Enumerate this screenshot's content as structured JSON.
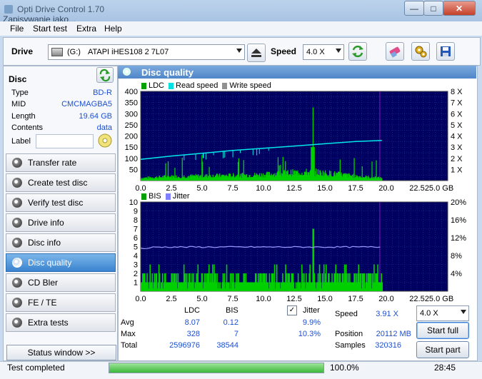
{
  "window": {
    "title": "Opti Drive Control 1.70",
    "subtitle": "Zapisywanie jako...",
    "close_label": "✕"
  },
  "menu": [
    "File",
    "Start test",
    "Extra",
    "Help"
  ],
  "toolbar": {
    "drive_label": "Drive",
    "drive_letter": "(G:)",
    "drive_name": "ATAPI iHES108   2 7L07",
    "speed_label": "Speed",
    "speed_value": "4.0 X"
  },
  "disc": {
    "header": "Disc",
    "rows": [
      {
        "label": "Type",
        "value": "BD-R"
      },
      {
        "label": "MID",
        "value": "CMCMAGBA5"
      },
      {
        "label": "Length",
        "value": "19.64 GB"
      },
      {
        "label": "Contents",
        "value": "data"
      },
      {
        "label": "Label",
        "value": ""
      }
    ]
  },
  "nav": [
    "Transfer rate",
    "Create test disc",
    "Verify test disc",
    "Drive info",
    "Disc info",
    "Disc quality",
    "CD Bler",
    "FE / TE",
    "Extra tests"
  ],
  "nav_active": 5,
  "status_window": "Status window >>",
  "panel": {
    "title": "Disc quality"
  },
  "chart_data": [
    {
      "type": "area",
      "series": [
        {
          "name": "LDC",
          "color": "#00c000"
        },
        {
          "name": "Read speed",
          "color": "#00ffff"
        },
        {
          "name": "Write speed",
          "color": "#909090"
        }
      ],
      "x_ticks": [
        "0.0",
        "2.5",
        "5.0",
        "7.5",
        "10.0",
        "12.5",
        "15.0",
        "17.5",
        "20.0",
        "22.5",
        "25.0 GB"
      ],
      "y_ticks": [
        "400",
        "350",
        "300",
        "250",
        "200",
        "150",
        "100",
        "50"
      ],
      "y2_ticks": [
        "8 X",
        "7 X",
        "6 X",
        "5 X",
        "4 X",
        "3 X",
        "2 X",
        "1 X"
      ],
      "ylim": [
        0,
        400
      ],
      "xlim": [
        0,
        25
      ],
      "data_end_x": 19.64,
      "read_speed": {
        "x": [
          0,
          2.5,
          5,
          7.5,
          10,
          12.5,
          15,
          17.5,
          19.64
        ],
        "y": [
          1.9,
          2.2,
          2.45,
          2.7,
          2.9,
          3.1,
          3.3,
          3.5,
          3.6
        ]
      },
      "ldc_baseline": {
        "x": [
          0,
          2,
          5,
          7.5,
          10,
          12,
          14,
          16,
          18,
          19.64
        ],
        "y": [
          12,
          18,
          22,
          24,
          28,
          36,
          40,
          30,
          18,
          12
        ]
      },
      "ldc_peak": {
        "x": 14.0,
        "y": 328
      }
    },
    {
      "type": "area",
      "series": [
        {
          "name": "BIS",
          "color": "#00c000"
        },
        {
          "name": "Jitter",
          "color": "#8080ff"
        }
      ],
      "x_ticks": [
        "0.0",
        "2.5",
        "5.0",
        "7.5",
        "10.0",
        "12.5",
        "15.0",
        "17.5",
        "20.0",
        "22.5",
        "25.0 GB"
      ],
      "y_ticks": [
        "10",
        "9",
        "8",
        "7",
        "6",
        "5",
        "4",
        "3",
        "2",
        "1"
      ],
      "y2_ticks": [
        "20%",
        "16%",
        "12%",
        "8%",
        "4%"
      ],
      "ylim": [
        0,
        10
      ],
      "xlim": [
        0,
        25
      ],
      "data_end_x": 19.64,
      "jitter_pct": 9.9,
      "bis_typical": 1,
      "bis_peak": {
        "x": 14.0,
        "y": 7
      }
    }
  ],
  "stats": {
    "col_ldc": "LDC",
    "col_bis": "BIS",
    "jitter_label": "Jitter",
    "rows": [
      {
        "label": "Avg",
        "ldc": "8.07",
        "bis": "0.12",
        "jitter": "9.9%"
      },
      {
        "label": "Max",
        "ldc": "328",
        "bis": "7",
        "jitter": "10.3%"
      },
      {
        "label": "Total",
        "ldc": "2596976",
        "bis": "38544",
        "jitter": ""
      }
    ],
    "speed_label": "Speed",
    "speed_value": "3.91 X",
    "position_label": "Position",
    "position_value": "20112 MB",
    "samples_label": "Samples",
    "samples_value": "320316",
    "speed_select": "4.0 X",
    "start_full": "Start full",
    "start_part": "Start part"
  },
  "status": {
    "text": "Test completed",
    "progress": 100,
    "progress_label": "100.0%",
    "time": "28:45"
  }
}
